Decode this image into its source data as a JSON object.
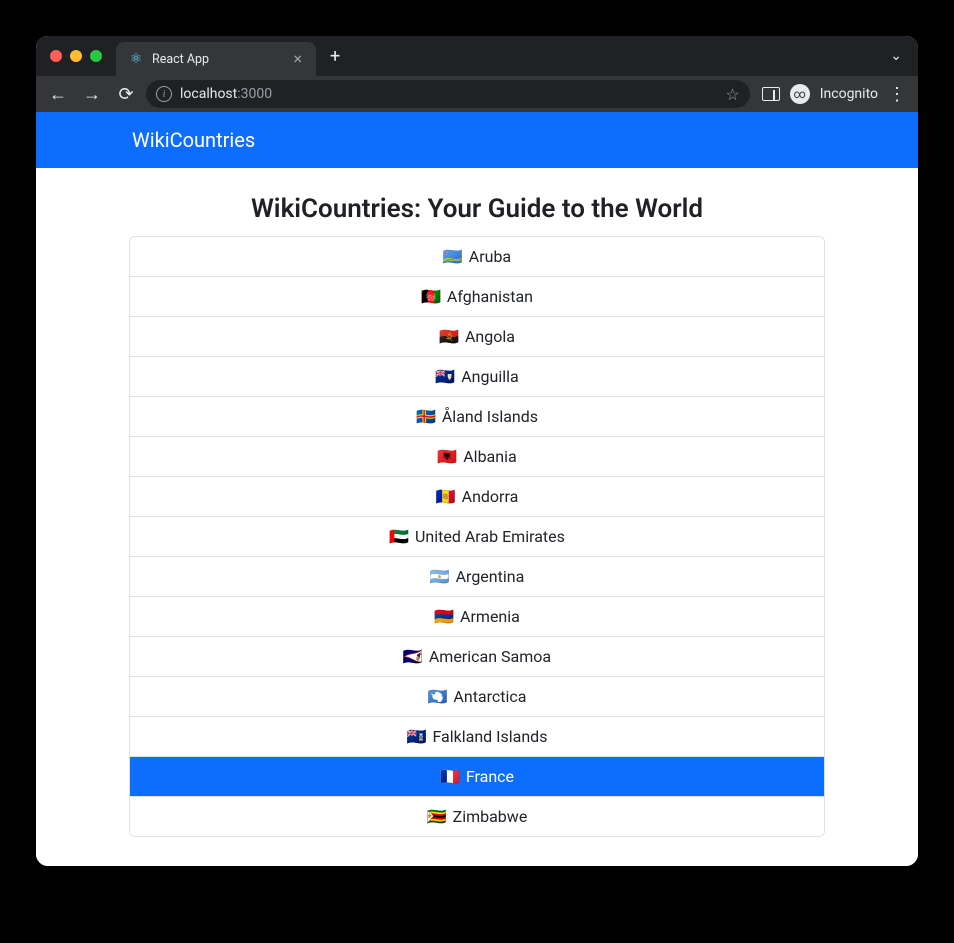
{
  "browser": {
    "tab_title": "React App",
    "url_host": "localhost",
    "url_port": ":3000",
    "incognito_label": "Incognito"
  },
  "navbar": {
    "brand": "WikiCountries"
  },
  "page": {
    "title": "WikiCountries: Your Guide to the World"
  },
  "countries": [
    {
      "flag": "🇦🇼",
      "name": "Aruba",
      "active": false
    },
    {
      "flag": "🇦🇫",
      "name": "Afghanistan",
      "active": false
    },
    {
      "flag": "🇦🇴",
      "name": "Angola",
      "active": false
    },
    {
      "flag": "🇦🇮",
      "name": "Anguilla",
      "active": false
    },
    {
      "flag": "🇦🇽",
      "name": "Åland Islands",
      "active": false
    },
    {
      "flag": "🇦🇱",
      "name": "Albania",
      "active": false
    },
    {
      "flag": "🇦🇩",
      "name": "Andorra",
      "active": false
    },
    {
      "flag": "🇦🇪",
      "name": "United Arab Emirates",
      "active": false
    },
    {
      "flag": "🇦🇷",
      "name": "Argentina",
      "active": false
    },
    {
      "flag": "🇦🇲",
      "name": "Armenia",
      "active": false
    },
    {
      "flag": "🇦🇸",
      "name": "American Samoa",
      "active": false
    },
    {
      "flag": "🇦🇶",
      "name": "Antarctica",
      "active": false
    },
    {
      "flag": "🇫🇰",
      "name": "Falkland Islands",
      "active": false
    },
    {
      "flag": "🇫🇷",
      "name": "France",
      "active": true
    },
    {
      "flag": "🇿🇼",
      "name": "Zimbabwe",
      "active": false
    }
  ]
}
